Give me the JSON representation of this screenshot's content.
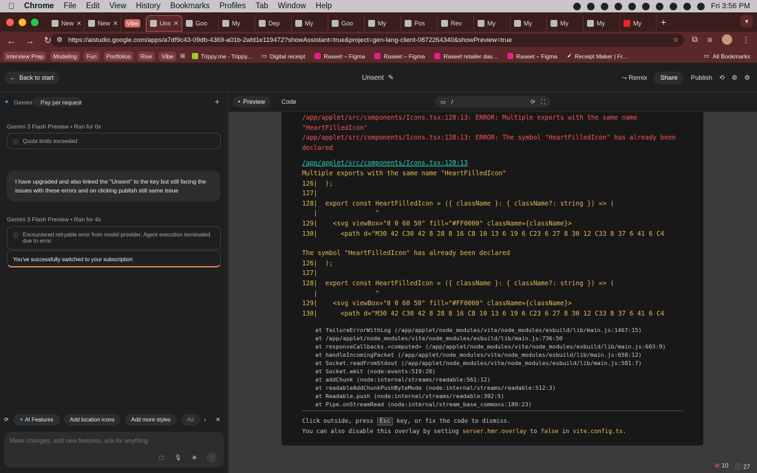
{
  "menubar": {
    "app": "Chrome",
    "items": [
      "File",
      "Edit",
      "View",
      "History",
      "Bookmarks",
      "Profiles",
      "Tab",
      "Window",
      "Help"
    ],
    "clock": "Fri 3:56 PM"
  },
  "tabs": [
    {
      "label": "New"
    },
    {
      "label": "New"
    },
    {
      "label": "Vibe"
    },
    {
      "label": "Uns"
    },
    {
      "label": "Goo"
    },
    {
      "label": "My"
    },
    {
      "label": "Dep"
    },
    {
      "label": "My"
    },
    {
      "label": "Goo"
    },
    {
      "label": "My"
    },
    {
      "label": "Pos"
    },
    {
      "label": "Rev"
    },
    {
      "label": "My"
    },
    {
      "label": "My"
    },
    {
      "label": "My"
    },
    {
      "label": "My"
    },
    {
      "label": "My"
    }
  ],
  "address": {
    "url": "https://aistudio.google.com/apps/a7df9c43-09db-4369-a01b-2afd1e119472?showAssistant=true&project=gen-lang-client-0872264340&showPreview=true"
  },
  "bookmarks": {
    "items": [
      "Interview Prep",
      "Modeling",
      "Fun",
      "Portfolios",
      "Rive",
      "Vibe",
      "Trippy.me - Trippy...",
      "Digital receipt",
      "Raseet – Figma",
      "Raseet – Figma",
      "Raseet retailer das...",
      "Raseet – Figma",
      "Receipt Maker | Fr..."
    ],
    "all": "All Bookmarks"
  },
  "header": {
    "back": "Back to start",
    "title": "Unsent",
    "remix": "Remix",
    "share": "Share",
    "publish": "Publish"
  },
  "chat": {
    "model_label": "Gemini",
    "billing": "Pay per request",
    "run1": "Gemini 3 Flash Preview • Ran for 0s",
    "quota": "Quota limits exceeded",
    "user_msg": "I have upgraded and also linked the \"Unsent\" to the key but still facing the issues with these errors and on clicking publish still same issue",
    "run2": "Gemini 3 Flash Preview • Ran for 4s",
    "error": "Encountered retryable error from model provider: Agent execution terminated due to error.",
    "success": "You've successfully switched to your subscription",
    "chips": [
      "AI Features",
      "Add location icons",
      "Add more styles",
      "Ad"
    ],
    "placeholder": "Make changes, add new features, ask for anything"
  },
  "preview": {
    "tab_preview": "Preview",
    "tab_code": "Code",
    "path": "/"
  },
  "overlay": {
    "err1": "/app/applet/src/components/Icons.tsx:128:13: ERROR: Multiple exports with the same name \"HeartFilledIcon\"",
    "err2": "/app/applet/src/components/Icons.tsx:128:13: ERROR: The symbol \"HeartFilledIcon\" has already been declared",
    "file": "/app/applet/src/components/Icons.tsx:128:13",
    "msg1": "Multiple exports with the same name \"HeartFilledIcon\"",
    "code1": "126|  );\n127|\n128|  export const HeartFilledIcon = ({ className }: { className?: string }) => (\n   |               ^\n129|    <svg viewBox=\"0 0 60 50\" fill=\"#FF0000\" className={className}>\n130|      <path d=\"M30 42 C30 42 8 28 8 16 C8 10 13 6 19 6 C23 6 27 8 30 12 C33 8 37 6 41 6 C4",
    "msg2": "The symbol \"HeartFilledIcon\" has already been declared",
    "code2": "126|  );\n127|\n128|  export const HeartFilledIcon = ({ className }: { className?: string }) => (\n   |               ^\n129|    <svg viewBox=\"0 0 60 50\" fill=\"#FF0000\" className={className}>\n130|      <path d=\"M30 42 C30 42 8 28 8 16 C8 10 13 6 19 6 C23 6 27 8 30 12 C33 8 37 6 41 6 C4",
    "stack": "at failureErrorWithLog (/app/applet/node_modules/vite/node_modules/esbuild/lib/main.js:1467:15)\nat /app/applet/node_modules/vite/node_modules/esbuild/lib/main.js:736:50\nat responseCallbacks.<computed> (/app/applet/node_modules/vite/node_modules/esbuild/lib/main.js:603:9)\nat handleIncomingPacket (/app/applet/node_modules/vite/node_modules/esbuild/lib/main.js:658:12)\nat Socket.readFromStdout (/app/applet/node_modules/vite/node_modules/esbuild/lib/main.js:581:7)\nat Socket.emit (node:events:519:28)\nat addChunk (node:internal/streams/readable:561:12)\nat readableAddChunkPushByteMode (node:internal/streams/readable:512:3)\nat Readable.push (node:internal/streams/readable:392:5)\nat Pipe.onStreamRead (node:internal/stream_base_commons:189:23)",
    "foot1_a": "Click outside, press",
    "foot1_key": "Esc",
    "foot1_b": "key, or fix the code to dismiss.",
    "foot2_a": "You can also disable this overlay by setting",
    "foot2_setting": "server.hmr.overlay",
    "foot2_to": "to",
    "foot2_false": "false",
    "foot2_in": "in",
    "foot2_file": "vite.config.ts."
  },
  "status": {
    "errors": "10",
    "warnings": "27"
  }
}
